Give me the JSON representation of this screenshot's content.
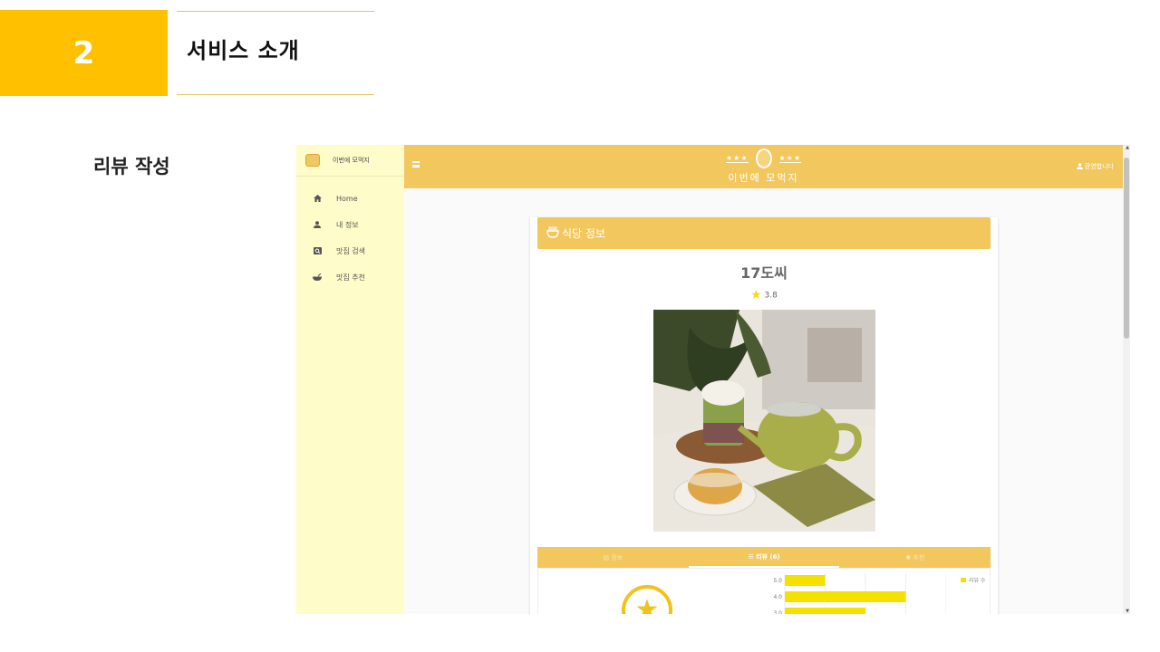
{
  "slide": {
    "number": "2",
    "title": "서비스 소개",
    "section_label": "리뷰 작성"
  },
  "app": {
    "brand": "이번에 모먹지",
    "logo_stars_left": "★★★",
    "logo_stars_right": "★★★",
    "logo_text": "이번에 모먹지",
    "welcome": "환영합니다",
    "nav": [
      {
        "icon": "home-icon",
        "label": "Home"
      },
      {
        "icon": "person-icon",
        "label": "내 정보"
      },
      {
        "icon": "search-icon",
        "label": "맛집 검색"
      },
      {
        "icon": "bowl-icon",
        "label": "맛집 추천"
      }
    ]
  },
  "restaurant": {
    "section_title": "식당 정보",
    "name": "17도씨",
    "rating": "3.8"
  },
  "tabs": [
    {
      "icon": "info-icon",
      "label": "정보"
    },
    {
      "icon": "list-icon",
      "label": "리뷰 (6)"
    },
    {
      "icon": "recommend-icon",
      "label": "추천"
    }
  ],
  "colors": {
    "slide_accent": "#ffc000",
    "app_primary": "#f2c75e",
    "sidebar_bg": "#fefcc9",
    "bar_color": "#f6e000"
  },
  "chart_data": {
    "type": "bar",
    "orientation": "horizontal",
    "categories": [
      "5.0",
      "4.0",
      "3.0"
    ],
    "series": [
      {
        "name": "리뷰 수",
        "values": [
          1,
          3,
          2
        ]
      }
    ],
    "xlim": [
      0,
      4
    ],
    "grid": true,
    "legend": "top-right"
  }
}
